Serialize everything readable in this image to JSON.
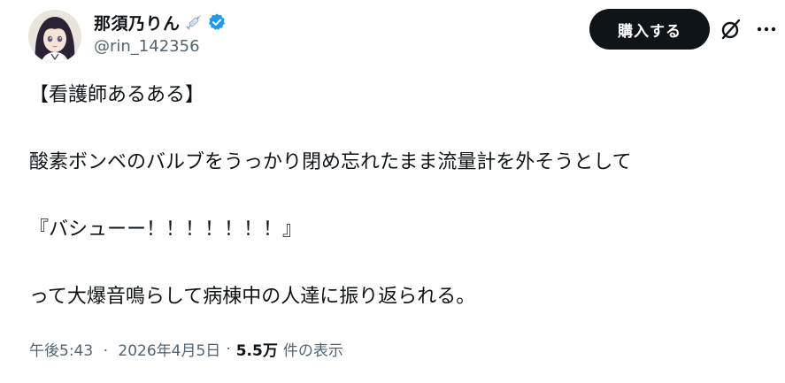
{
  "author": {
    "display_name": "那須乃りん",
    "handle": "@rin_142356",
    "name_emoji": "syringe-icon",
    "verified_icon": "verified-badge-icon",
    "verified_color": "#1d9bf0"
  },
  "actions": {
    "subscribe_label": "購入する",
    "grok_icon": "grok-icon",
    "more_icon": "more-icon"
  },
  "tweet": {
    "lines": [
      "【看護師あるある】",
      "",
      "酸素ボンベのバルブをうっかり閉め忘れたまま流量計を外そうとして",
      "",
      "『バシューー！！！！！！！』",
      "",
      "って大爆音鳴らして病棟中の人達に振り返られる。"
    ]
  },
  "meta": {
    "time": "午後5:43",
    "separator": "·",
    "date": "2026年4月5日",
    "views_count": "5.5万",
    "views_label": "件の表示"
  },
  "colors": {
    "text_primary": "#0f1419",
    "text_secondary": "#536471",
    "button_bg": "#0f1419",
    "button_text": "#ffffff"
  }
}
